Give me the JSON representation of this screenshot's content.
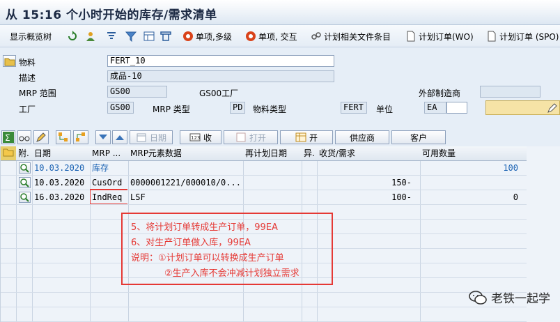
{
  "window": {
    "title": "从 15:16 个小时开始的库存/需求清单"
  },
  "app_toolbar": {
    "overview_tree": "显示概览树",
    "single_item_multi": "单项,多级",
    "single_item_interactive": "单项, 交互",
    "planning_file": "计划相关文件条目",
    "planned_order_wo": "计划订单(WO)",
    "planned_order_spo": "计划订单 (SPO)"
  },
  "header": {
    "material_label": "物料",
    "material_value": "FERT_10",
    "description_label": "描述",
    "description_value": "成品-10",
    "mrp_area_label": "MRP 范围",
    "mrp_area_value": "GS00",
    "mrp_area_plant_text": "GS00工厂",
    "ext_procurement_label": "外部制造商",
    "plant_label": "工厂",
    "plant_value": "GS00",
    "mrp_type_label": "MRP 类型",
    "mrp_type_value": "PD",
    "material_type_label": "物料类型",
    "material_type_value": "FERT",
    "unit_label": "单位",
    "unit_value": "EA"
  },
  "grid_toolbar": {
    "date_btn": "日期",
    "receipt_btn": "收",
    "open_btn": "打开",
    "open2_btn": "开",
    "vendor_btn": "供应商",
    "customer_btn": "客户"
  },
  "columns": {
    "attach": "附.",
    "date": "日期",
    "mrp_element": "MRP ...",
    "mrp_element_data": "MRP元素数据",
    "reschedule_date": "再计划日期",
    "exception": "异.",
    "receipt_req": "收货/需求",
    "available_qty": "可用数量"
  },
  "rows": [
    {
      "date": "10.03.2020",
      "element": "库存",
      "data": "",
      "reschedule": "",
      "qty": "",
      "available": "100"
    },
    {
      "date": "10.03.2020",
      "element": "CusOrd",
      "data": "0000001221/000010/0...",
      "reschedule": "",
      "qty": "150-",
      "available": ""
    },
    {
      "date": "16.03.2020",
      "element": "IndReq",
      "data": "LSF",
      "reschedule": "",
      "qty": "100-",
      "available": "0"
    }
  ],
  "annotation": {
    "line1": "5、将计划订单转成生产订单，99EA",
    "line2": "6、对生产订单做入库，99EA",
    "line3": "说明：①计划订单可以转换成生产订单",
    "line4": "②生产入库不会冲减计划独立需求"
  },
  "watermark": {
    "text": "老铁一起学"
  }
}
